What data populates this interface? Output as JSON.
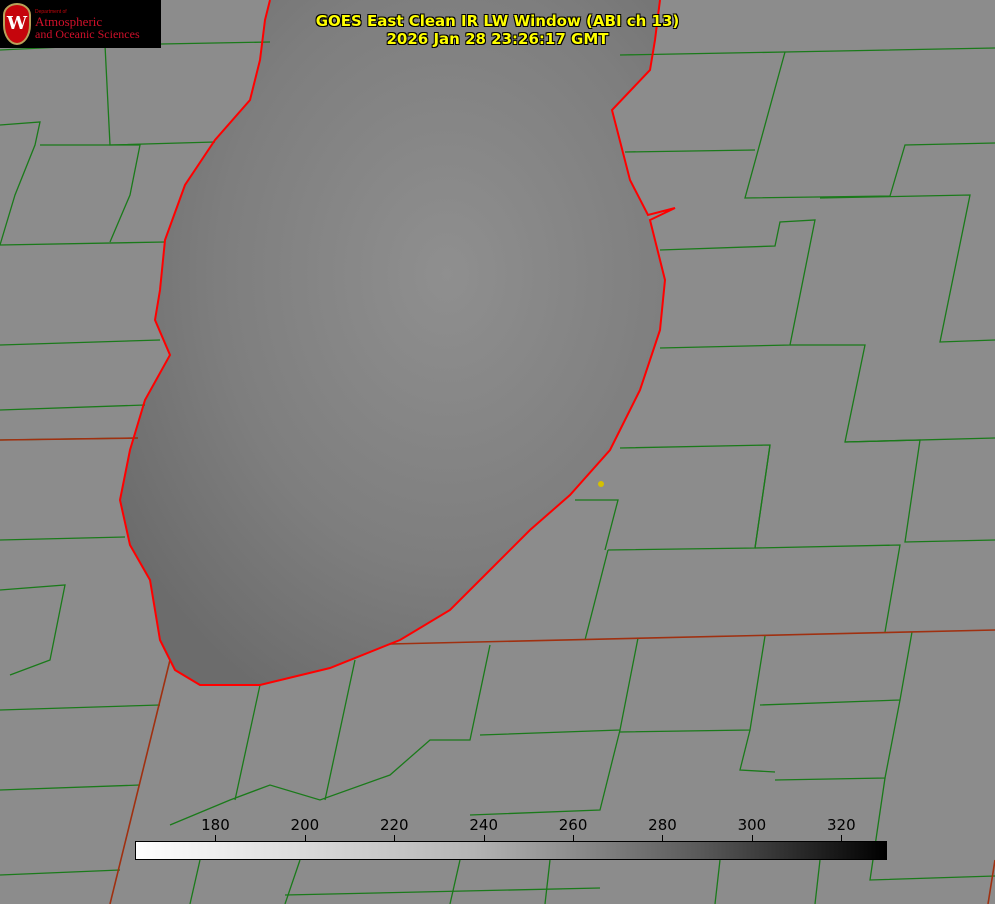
{
  "title": {
    "line1": "GOES East Clean IR LW Window (ABI ch 13)",
    "line2": "2026 Jan 28 23:26:17 GMT"
  },
  "logo": {
    "dept": "Department of",
    "line1": "Atmospheric",
    "line2": "and Oceanic Sciences",
    "seal_letter": "W"
  },
  "colorbar": {
    "min": 162,
    "max": 330,
    "ticks": [
      "180",
      "200",
      "220",
      "240",
      "260",
      "280",
      "300",
      "320"
    ],
    "colors": {
      "low": "#ffffff",
      "high": "#000000"
    }
  },
  "colors": {
    "county": "#1a7a1a",
    "coast": "#ff0000",
    "marker": "#d4c000"
  }
}
